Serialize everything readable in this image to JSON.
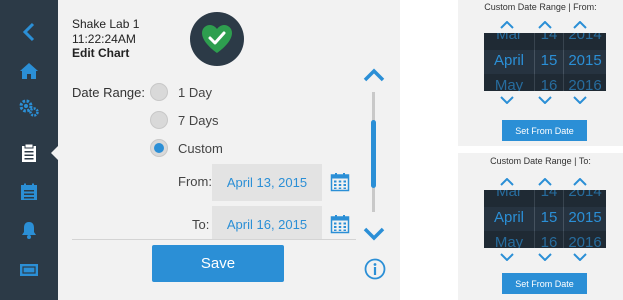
{
  "sidebar": {
    "items": [
      {
        "icon": "back-chevron-icon"
      },
      {
        "icon": "home-icon"
      },
      {
        "icon": "settings-gears-icon"
      },
      {
        "icon": "clipboard-icon",
        "active": true
      },
      {
        "icon": "calendar-list-icon"
      },
      {
        "icon": "bell-icon"
      },
      {
        "icon": "ticket-icon"
      }
    ]
  },
  "header": {
    "device_name": "Shake Lab 1",
    "time": "11:22:24AM",
    "screen_title": "Edit Chart",
    "status_icon": "heart-check-icon",
    "status_color": "#2e9e4f"
  },
  "date_range": {
    "label": "Date Range:",
    "options": [
      {
        "label": "1 Day",
        "selected": false
      },
      {
        "label": "7 Days",
        "selected": false
      },
      {
        "label": "Custom",
        "selected": true
      }
    ],
    "from_label": "From:",
    "from_value": "April 13, 2015",
    "to_label": "To:",
    "to_value": "April 16, 2015"
  },
  "actions": {
    "save_label": "Save"
  },
  "picker_from": {
    "title": "Custom Date Range | From:",
    "month": {
      "prev": "Mar",
      "cur": "April",
      "next": "May"
    },
    "day": {
      "prev": "14",
      "cur": "15",
      "next": "16"
    },
    "year": {
      "prev": "2014",
      "cur": "2015",
      "next": "2016"
    },
    "button_label": "Set From Date"
  },
  "picker_to": {
    "title": "Custom Date Range | To:",
    "month": {
      "prev": "Mar",
      "cur": "April",
      "next": "May"
    },
    "day": {
      "prev": "14",
      "cur": "15",
      "next": "16"
    },
    "year": {
      "prev": "2014",
      "cur": "2015",
      "next": "2016"
    },
    "button_label": "Set From Date"
  },
  "colors": {
    "accent": "#2b8fd6",
    "sidebar_bg": "#2c3a47",
    "panel_bg": "#f2f2f2"
  }
}
